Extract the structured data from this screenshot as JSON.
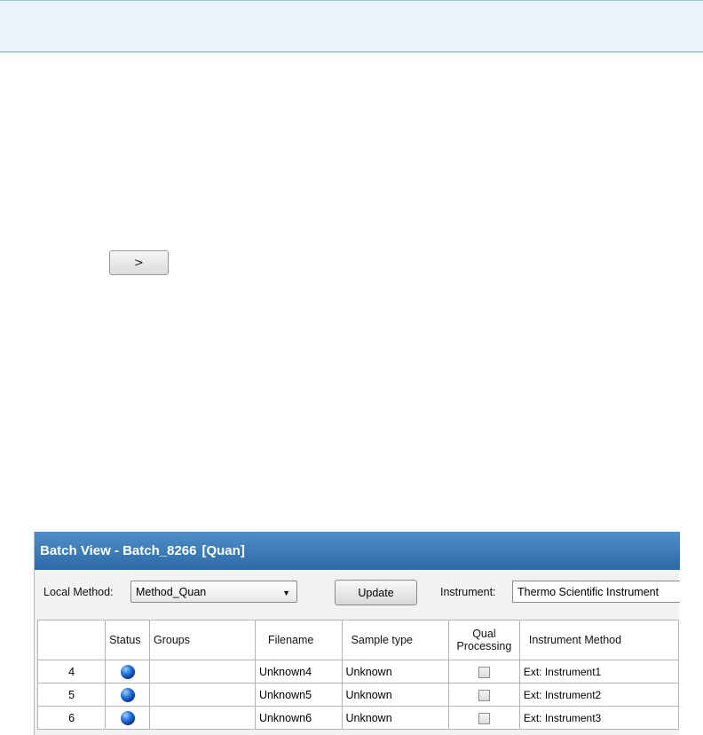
{
  "expand_button": {
    "label": ">"
  },
  "batch_view": {
    "title": "Batch View - Batch_8266",
    "mode": "[Quan]",
    "local_method_label": "Local Method:",
    "local_method_value": "Method_Quan",
    "update_label": "Update",
    "instrument_label": "Instrument:",
    "instrument_value": "Thermo Scientific Instrument"
  },
  "table": {
    "columns": [
      "",
      "Status",
      "Groups",
      "Filename",
      "Sample type",
      "Qual Processing",
      "Instrument Method"
    ],
    "rows": [
      {
        "row": "4",
        "status": "queued",
        "groups": "",
        "filename": "Unknown4",
        "sample_type": "Unknown",
        "qual_processing": false,
        "instrument_method": "Ext: Instrument1"
      },
      {
        "row": "5",
        "status": "queued",
        "groups": "",
        "filename": "Unknown5",
        "sample_type": "Unknown",
        "qual_processing": false,
        "instrument_method": "Ext: Instrument2"
      },
      {
        "row": "6",
        "status": "queued",
        "groups": "",
        "filename": "Unknown6",
        "sample_type": "Unknown",
        "qual_processing": false,
        "instrument_method": "Ext: Instrument3"
      }
    ]
  },
  "colors": {
    "header_blue": "#2e6aa6",
    "status_dot": "#2a7be0",
    "banner": "#eaf3fb"
  }
}
